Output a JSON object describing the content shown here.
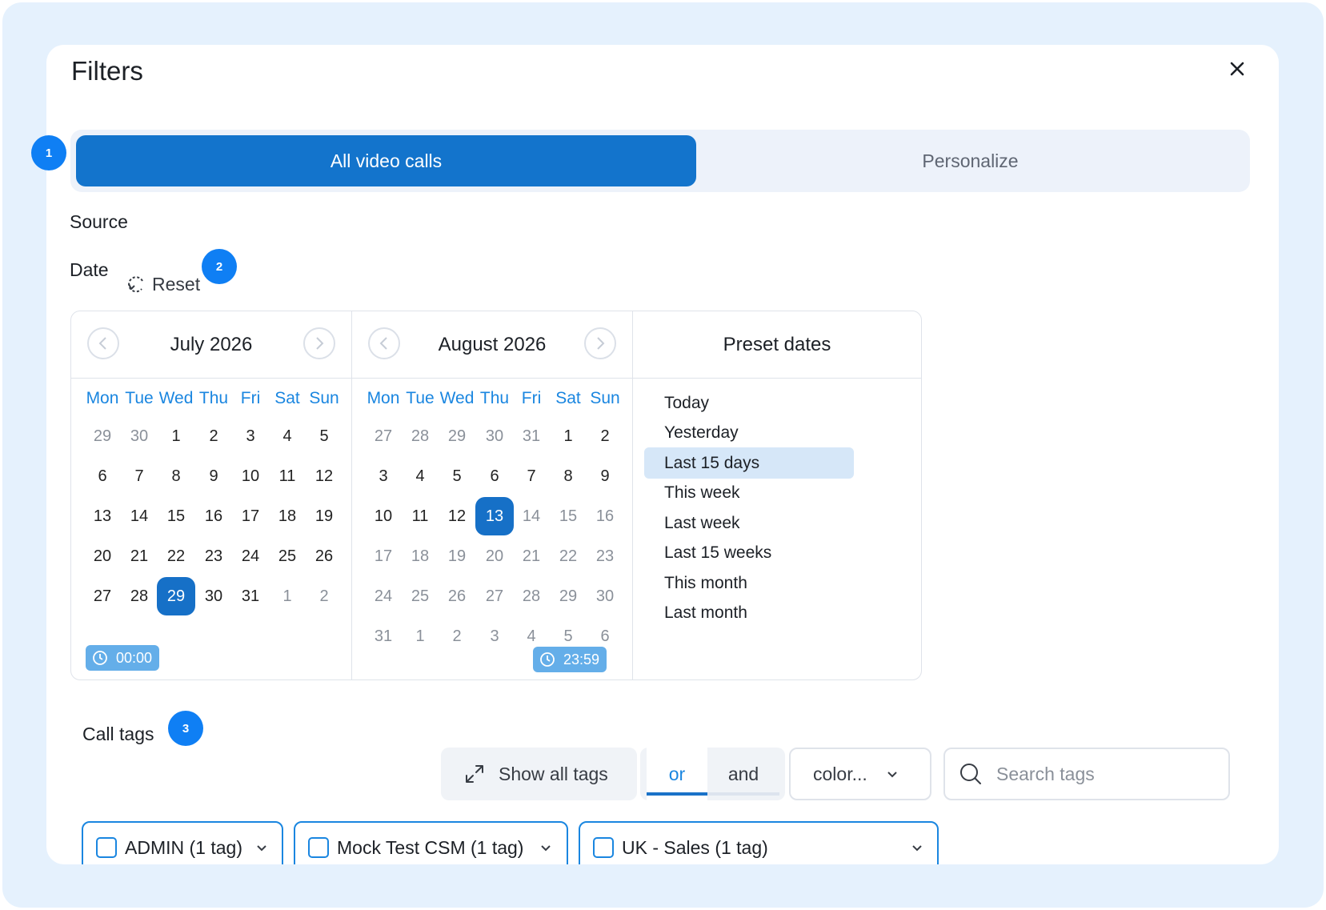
{
  "modal": {
    "title": "Filters"
  },
  "steps": [
    "1",
    "2",
    "3"
  ],
  "scope": {
    "active": "All video calls",
    "inactive": "Personalize"
  },
  "source_label": "Source",
  "date": {
    "label": "Date",
    "reset_label": "Reset"
  },
  "weekdays": [
    "Mon",
    "Tue",
    "Wed",
    "Thu",
    "Fri",
    "Sat",
    "Sun"
  ],
  "calendars": [
    {
      "title": "July 2026",
      "start_time": "00:00",
      "weeks": [
        [
          {
            "d": "29",
            "muted": true
          },
          {
            "d": "30",
            "muted": true
          },
          {
            "d": "1"
          },
          {
            "d": "2"
          },
          {
            "d": "3"
          },
          {
            "d": "4"
          },
          {
            "d": "5"
          }
        ],
        [
          {
            "d": "6"
          },
          {
            "d": "7"
          },
          {
            "d": "8"
          },
          {
            "d": "9"
          },
          {
            "d": "10"
          },
          {
            "d": "11"
          },
          {
            "d": "12"
          }
        ],
        [
          {
            "d": "13"
          },
          {
            "d": "14"
          },
          {
            "d": "15"
          },
          {
            "d": "16"
          },
          {
            "d": "17"
          },
          {
            "d": "18"
          },
          {
            "d": "19"
          }
        ],
        [
          {
            "d": "20"
          },
          {
            "d": "21"
          },
          {
            "d": "22"
          },
          {
            "d": "23"
          },
          {
            "d": "24"
          },
          {
            "d": "25"
          },
          {
            "d": "26"
          }
        ],
        [
          {
            "d": "27"
          },
          {
            "d": "28"
          },
          {
            "d": "29",
            "selected": true
          },
          {
            "d": "30"
          },
          {
            "d": "31"
          },
          {
            "d": "1",
            "muted": true
          },
          {
            "d": "2",
            "muted": true
          }
        ]
      ]
    },
    {
      "title": "August 2026",
      "start_time": "23:59",
      "weeks": [
        [
          {
            "d": "27",
            "muted": true
          },
          {
            "d": "28",
            "muted": true
          },
          {
            "d": "29",
            "muted": true
          },
          {
            "d": "30",
            "muted": true
          },
          {
            "d": "31",
            "muted": true
          },
          {
            "d": "1"
          },
          {
            "d": "2"
          }
        ],
        [
          {
            "d": "3"
          },
          {
            "d": "4"
          },
          {
            "d": "5"
          },
          {
            "d": "6"
          },
          {
            "d": "7"
          },
          {
            "d": "8"
          },
          {
            "d": "9"
          }
        ],
        [
          {
            "d": "10"
          },
          {
            "d": "11"
          },
          {
            "d": "12"
          },
          {
            "d": "13",
            "selected": true
          },
          {
            "d": "14",
            "muted": true
          },
          {
            "d": "15",
            "muted": true
          },
          {
            "d": "16",
            "muted": true
          }
        ],
        [
          {
            "d": "17",
            "muted": true
          },
          {
            "d": "18",
            "muted": true
          },
          {
            "d": "19",
            "muted": true
          },
          {
            "d": "20",
            "muted": true
          },
          {
            "d": "21",
            "muted": true
          },
          {
            "d": "22",
            "muted": true
          },
          {
            "d": "23",
            "muted": true
          }
        ],
        [
          {
            "d": "24",
            "muted": true
          },
          {
            "d": "25",
            "muted": true
          },
          {
            "d": "26",
            "muted": true
          },
          {
            "d": "27",
            "muted": true
          },
          {
            "d": "28",
            "muted": true
          },
          {
            "d": "29",
            "muted": true
          },
          {
            "d": "30",
            "muted": true
          }
        ],
        [
          {
            "d": "31",
            "muted": true
          },
          {
            "d": "1",
            "muted": true
          },
          {
            "d": "2",
            "muted": true
          },
          {
            "d": "3",
            "muted": true
          },
          {
            "d": "4",
            "muted": true
          },
          {
            "d": "5",
            "muted": true
          },
          {
            "d": "6",
            "muted": true
          }
        ]
      ]
    }
  ],
  "presets": {
    "title": "Preset dates",
    "items": [
      "Today",
      "Yesterday",
      "Last 15 days",
      "This week",
      "Last week",
      "Last 15 weeks",
      "This month",
      "Last month"
    ],
    "active": "Last 15 days"
  },
  "call_tags": {
    "label": "Call tags",
    "show_all_label": "Show all tags",
    "logic": {
      "or_label": "or",
      "and_label": "and",
      "selected": "or"
    },
    "color_label": "color...",
    "search_placeholder": "Search tags",
    "groups": [
      "ADMIN (1 tag)",
      "Mock Test CSM (1 tag)",
      "UK - Sales (1 tag)"
    ]
  },
  "colors": {
    "accent": "#1374cc",
    "badge": "#0f7ff4",
    "weekday_text": "#1a86e0",
    "preset_highlight": "#d6e7f8",
    "time_chip": "#64aee9",
    "page_bg": "#e5f1fd"
  },
  "icons": [
    "close-icon",
    "reset-icon",
    "chevron-left-icon",
    "chevron-right-icon",
    "clock-icon",
    "expand-icon",
    "chevron-down-icon",
    "search-icon"
  ]
}
